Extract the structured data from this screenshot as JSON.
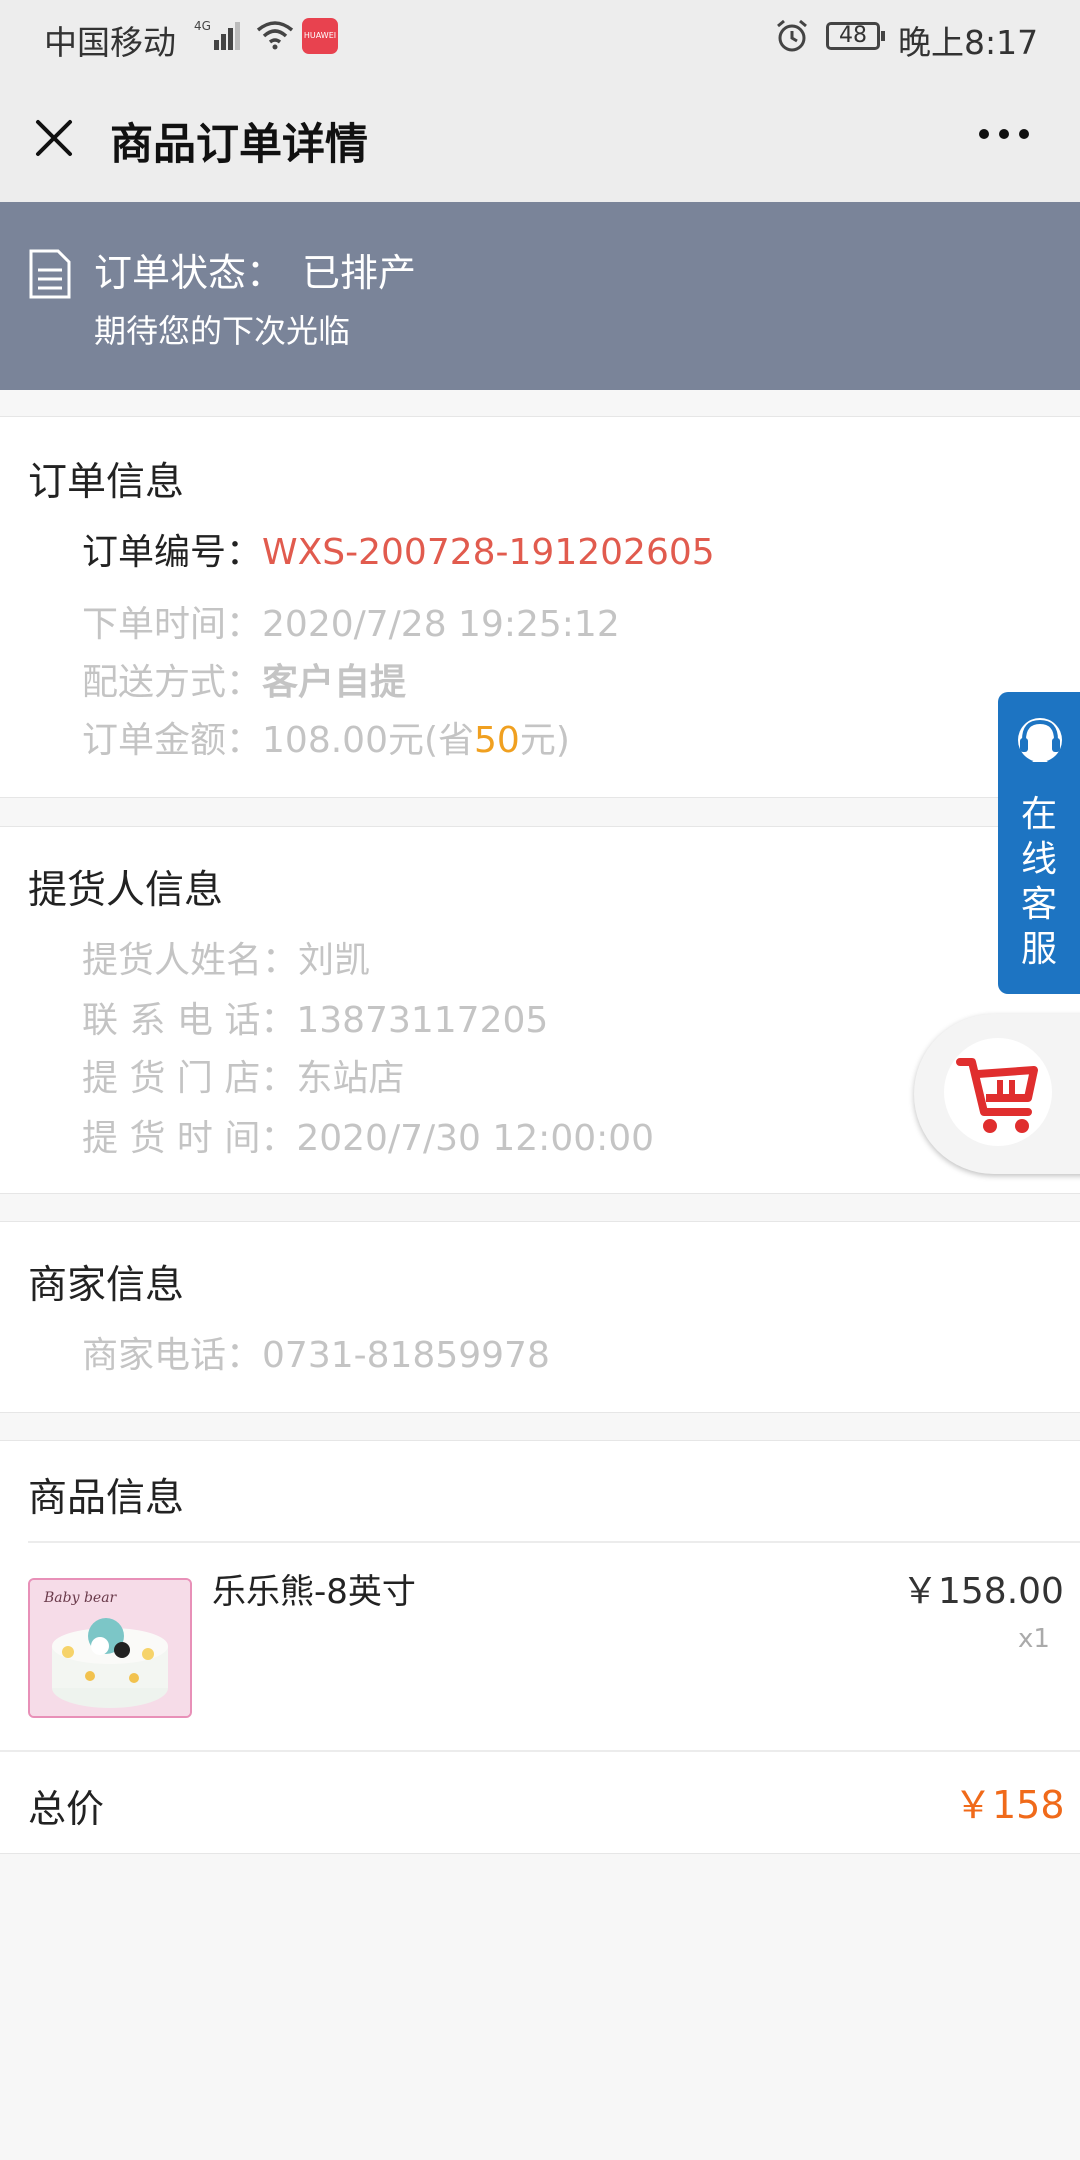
{
  "status_bar": {
    "carrier": "中国移动",
    "network": "4G",
    "app_badge": "HUAWEI",
    "battery": "48",
    "time": "晚上8:17"
  },
  "nav": {
    "title": "商品订单详情",
    "close_icon": "close-icon",
    "more_icon": "more-icon"
  },
  "banner": {
    "status_label": "订单状态：",
    "status_value": "已排产",
    "subtitle": "期待您的下次光临"
  },
  "order_info": {
    "heading": "订单信息",
    "number_label": "订单编号：",
    "number_value": "WXS-200728-191202605",
    "time_label": "下单时间：",
    "time_value": "2020/7/28 19:25:12",
    "delivery_label": "配送方式：",
    "delivery_value": "客户自提",
    "amount_label": "订单金额：",
    "amount_value": "108.00元(省",
    "amount_saved": "50",
    "amount_suffix": "元)"
  },
  "pickup_info": {
    "heading": "提货人信息",
    "name_label": "提货人姓名：",
    "name_value": "刘凯",
    "phone_label": "联 系 电 话：",
    "phone_value": "13873117205",
    "store_label": "提 货 门 店：",
    "store_value": "东站店",
    "time_label": "提 货 时 间：",
    "time_value": "2020/7/30 12:00:00"
  },
  "merchant_info": {
    "heading": "商家信息",
    "phone_label": "商家电话：",
    "phone_value": "0731-81859978"
  },
  "product_info": {
    "heading": "商品信息",
    "items": [
      {
        "name": "乐乐熊-8英寸",
        "price": "￥158.00",
        "qty": "x1",
        "image_text": "Baby bear"
      }
    ],
    "total_label": "总价",
    "total_value": "￥158"
  },
  "float": {
    "service_text": "在线客服",
    "cart_icon": "cart-icon"
  },
  "colors": {
    "banner": "#7a8499",
    "order_number": "#e15b4e",
    "saved": "#f0a020",
    "total": "#f06a1a",
    "service": "#1d74c2"
  }
}
